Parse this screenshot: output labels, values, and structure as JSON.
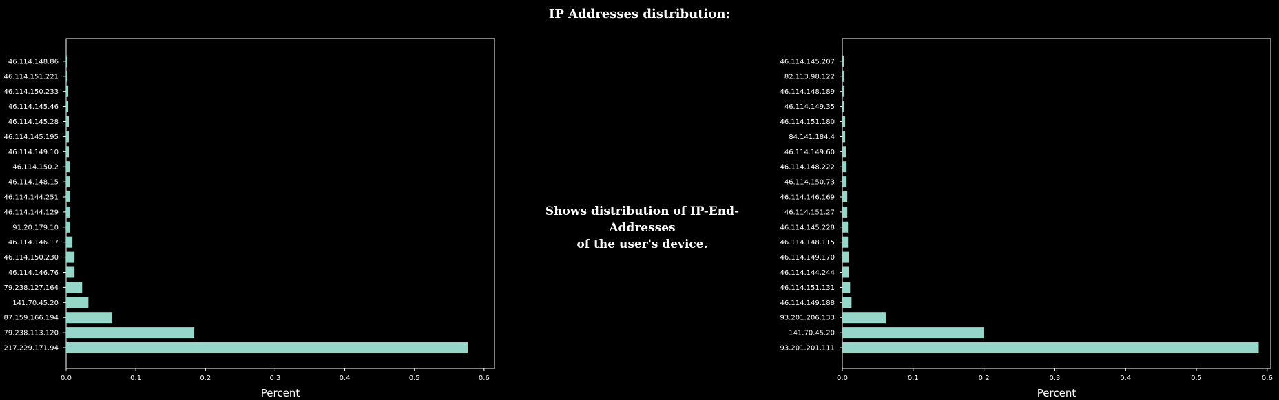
{
  "page": {
    "title": "IP Addresses distribution:",
    "description_line1": "Shows distribution of IP-End-Addresses",
    "description_line2": "of the user's device."
  },
  "chart_data": [
    {
      "type": "bar",
      "orientation": "horizontal",
      "xlabel": "Percent",
      "xlim": [
        0,
        0.615
      ],
      "xticks": [
        "0.0",
        "0.1",
        "0.2",
        "0.3",
        "0.4",
        "0.5",
        "0.6"
      ],
      "bar_color": "#96d6c8",
      "categories": [
        "217.229.171.94",
        "79.238.113.120",
        "87.159.166.194",
        "141.70.45.20",
        "79.238.127.164",
        "46.114.146.76",
        "46.114.150.230",
        "46.114.146.17",
        "91.20.179.10",
        "46.114.144.129",
        "46.114.144.251",
        "46.114.148.15",
        "46.114.150.2",
        "46.114.149.10",
        "46.114.145.195",
        "46.114.145.28",
        "46.114.145.46",
        "46.114.150.233",
        "46.114.151.221",
        "46.114.148.86"
      ],
      "values": [
        0.577,
        0.184,
        0.066,
        0.032,
        0.023,
        0.012,
        0.012,
        0.009,
        0.006,
        0.006,
        0.006,
        0.005,
        0.005,
        0.004,
        0.004,
        0.004,
        0.003,
        0.003,
        0.002,
        0.002
      ]
    },
    {
      "type": "bar",
      "orientation": "horizontal",
      "xlabel": "Percent",
      "xlim": [
        0,
        0.605
      ],
      "xticks": [
        "0.0",
        "0.1",
        "0.2",
        "0.3",
        "0.4",
        "0.5",
        "0.6"
      ],
      "bar_color": "#96d6c8",
      "categories": [
        "93.201.201.111",
        "141.70.45.20",
        "93.201.206.133",
        "46.114.149.188",
        "46.114.151.131",
        "46.114.144.244",
        "46.114.149.170",
        "46.114.148.115",
        "46.114.145.228",
        "46.114.151.27",
        "46.114.146.169",
        "46.114.150.73",
        "46.114.148.222",
        "46.114.149.60",
        "84.141.184.4",
        "46.114.151.180",
        "46.114.149.35",
        "46.114.148.189",
        "82.113.98.122",
        "46.114.145.207"
      ],
      "values": [
        0.588,
        0.2,
        0.062,
        0.013,
        0.011,
        0.009,
        0.009,
        0.008,
        0.008,
        0.007,
        0.007,
        0.006,
        0.006,
        0.005,
        0.004,
        0.004,
        0.003,
        0.003,
        0.003,
        0.002
      ]
    }
  ]
}
